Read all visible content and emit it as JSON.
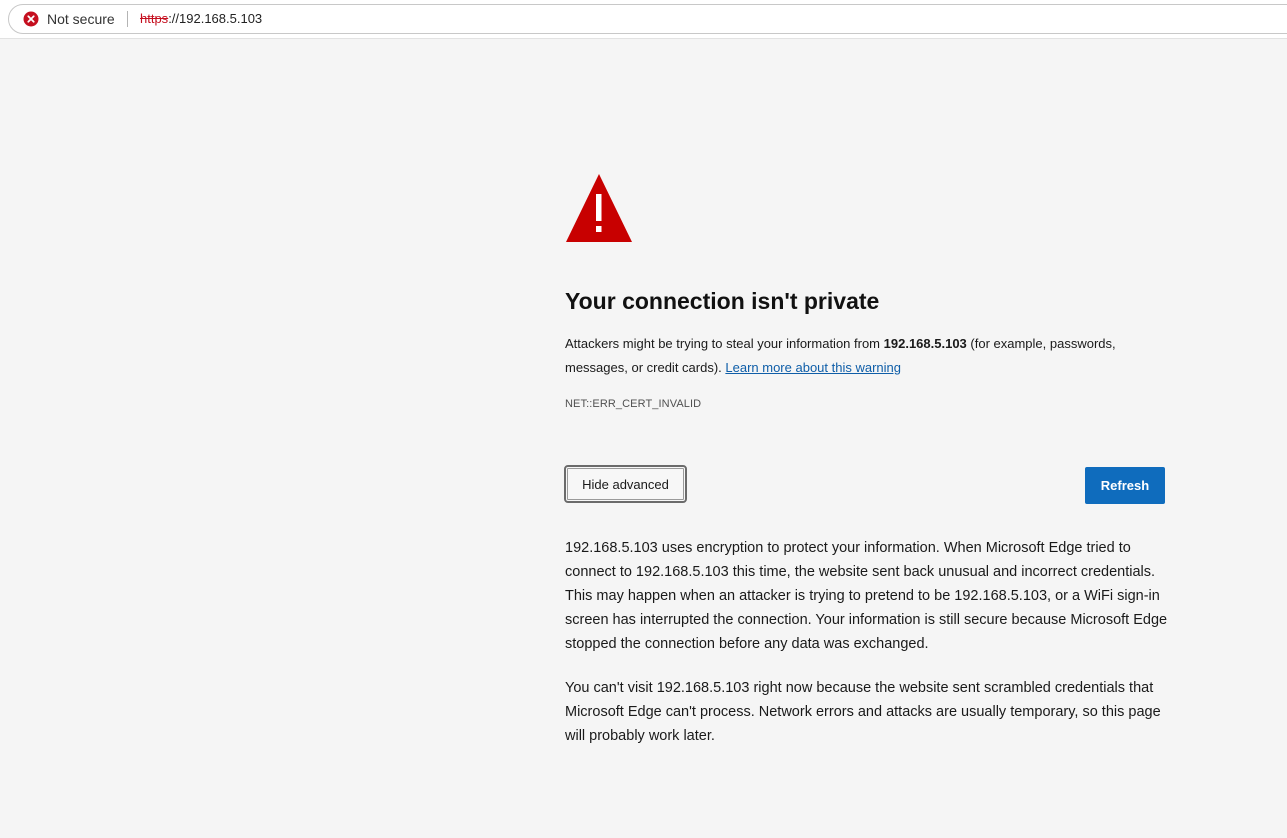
{
  "address_bar": {
    "security_label": "Not secure",
    "security_icon": "not-secure-error-icon",
    "url_scheme": "https",
    "url_rest": "://192.168.5.103"
  },
  "page": {
    "warning_icon": "warning-triangle-icon",
    "title": "Your connection isn't private",
    "description_prefix": "Attackers might be trying to steal your information from ",
    "host": "192.168.5.103",
    "description_suffix": " (for example, passwords, messages, or credit cards). ",
    "learn_more_link": "Learn more about this warning",
    "error_code": "NET::ERR_CERT_INVALID",
    "hide_advanced_label": "Hide advanced",
    "refresh_label": "Refresh",
    "advanced_paragraph_1": "192.168.5.103 uses encryption to protect your information. When Microsoft Edge tried to connect to 192.168.5.103 this time, the website sent back unusual and incorrect credentials. This may happen when an attacker is trying to pretend to be 192.168.5.103, or a WiFi sign-in screen has interrupted the connection. Your information is still secure because Microsoft Edge stopped the connection before any data was exchanged.",
    "advanced_paragraph_2": "You can't visit 192.168.5.103 right now because the website sent scrambled credentials that Microsoft Edge can't process. Network errors and attacks are usually temporary, so this page will probably work later."
  },
  "colors": {
    "background": "#f5f5f5",
    "error_red": "#c50f1f",
    "warning_red": "#c80000",
    "link_blue": "#0f5ea8",
    "primary_button": "#0f6cbd"
  }
}
